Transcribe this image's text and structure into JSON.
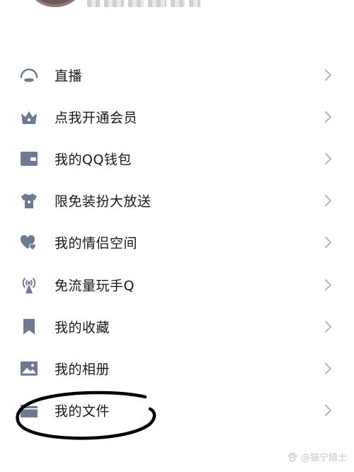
{
  "colors": {
    "icon": "#6e7a8f",
    "text": "#1a1a1a",
    "chevron": "#b5b5b5",
    "annotation": "#000000",
    "watermark": "#c8c8c8"
  },
  "menu": {
    "items": [
      {
        "label": "直播",
        "icon": "live-icon"
      },
      {
        "label": "点我开通会员",
        "icon": "crown-icon"
      },
      {
        "label": "我的QQ钱包",
        "icon": "wallet-icon"
      },
      {
        "label": "限免装扮大放送",
        "icon": "tshirt-icon"
      },
      {
        "label": "我的情侣空间",
        "icon": "couple-hearts-icon"
      },
      {
        "label": "免流量玩手Q",
        "icon": "signal-tower-icon"
      },
      {
        "label": "我的收藏",
        "icon": "bookmark-icon"
      },
      {
        "label": "我的相册",
        "icon": "photo-icon"
      },
      {
        "label": "我的文件",
        "icon": "folder-icon"
      }
    ]
  },
  "watermark": {
    "text": "@猫宁嬉士"
  }
}
